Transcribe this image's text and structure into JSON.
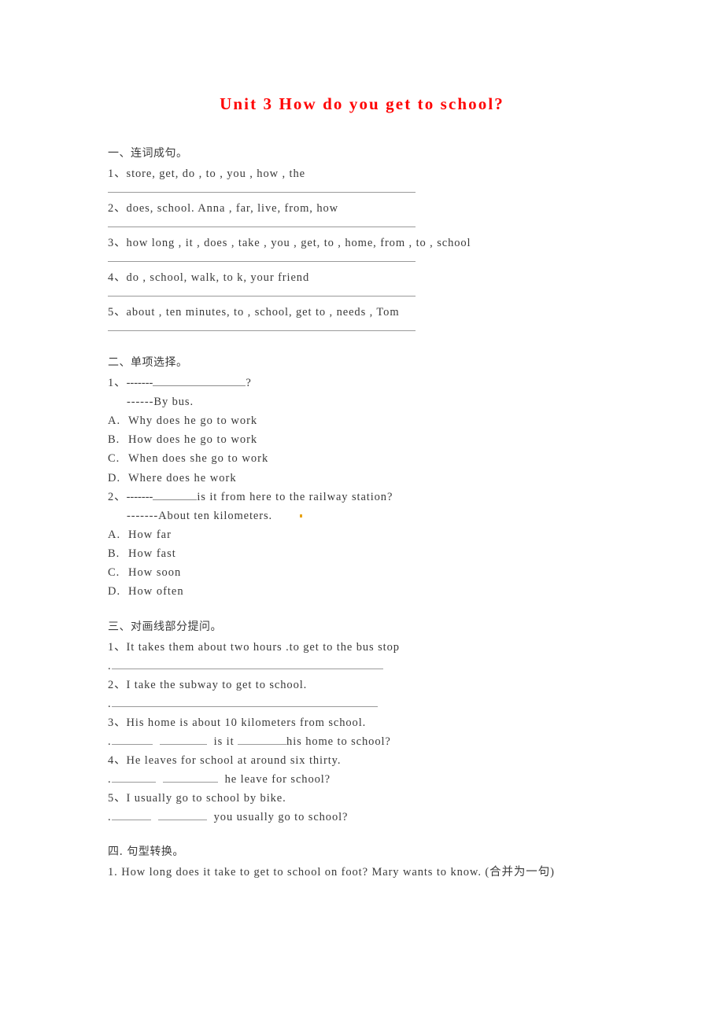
{
  "document": {
    "title": "Unit 3 How do you get to school?",
    "title_color": "#ff0000"
  },
  "sections": [
    {
      "heading": "一、连词成句。",
      "items": [
        "1、store, get, do , to , you , how , the",
        "2、does, school. Anna , far, live, from, how",
        "3、how long , it , does , take , you , get, to , home, from , to , school",
        "4、do , school, walk, to k, your friend",
        "5、about , ten minutes, to , school, get to , needs , Tom"
      ]
    },
    {
      "heading": "二、单项选择。",
      "q1_prompt_number": "1、",
      "q1_dashes": "-------",
      "q1_tail": "?",
      "q1_answer": "------By bus.",
      "q1_options": [
        {
          "label": "A.",
          "text": "Why does he go to work"
        },
        {
          "label": "B.",
          "text": "How does he go to work"
        },
        {
          "label": "C.",
          "text": "When does she go to work"
        },
        {
          "label": "D.",
          "text": "Where does he work"
        }
      ],
      "q2_prompt_number": "2、",
      "q2_dashes": "-------",
      "q2_tail": "is it from here to the railway station?",
      "q2_answer": "-------About ten kilometers.",
      "q2_options": [
        {
          "label": "A.",
          "text": "How far"
        },
        {
          "label": "B.",
          "text": "How fast"
        },
        {
          "label": "C.",
          "text": "How soon"
        },
        {
          "label": "D.",
          "text": "How often"
        }
      ]
    },
    {
      "heading": "三、对画线部分提问。",
      "items": [
        {
          "sentence": "1、It takes them about two hours .to get to the bus stop",
          "answer_prefix": "."
        },
        {
          "sentence": "2、I take the subway to get to school.",
          "answer_prefix": "."
        },
        {
          "sentence": "3、His home is about 10 kilometers from school.",
          "answer_prefix": "."
        },
        {
          "sentence": "4、He leaves for school at around six thirty.",
          "answer_prefix": "."
        },
        {
          "sentence": "5、I usually go to school by bike.",
          "answer_prefix": "."
        }
      ],
      "q3_mid": "is it",
      "q3_tail": "his home to school?",
      "q4_tail": "he leave for school?",
      "q5_tail": "you usually go to school?"
    },
    {
      "heading": "四. 句型转换。",
      "items": [
        "1. How long does it take to get to school on foot? Mary wants to know. (合并为一句)"
      ]
    }
  ]
}
